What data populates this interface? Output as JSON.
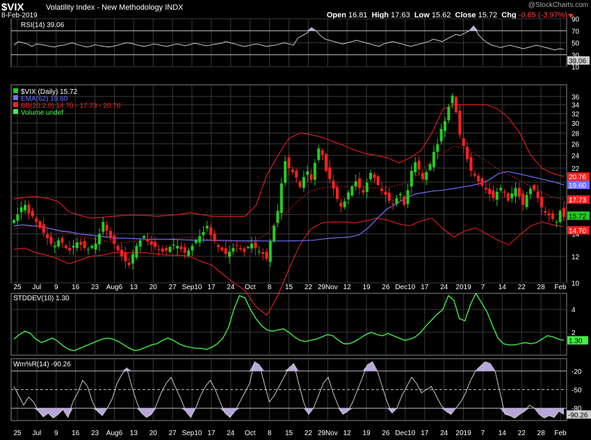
{
  "header": {
    "symbol": "$VIX",
    "name": "Volatility Index - New Methodology  INDX",
    "date": "8-Feb-2019",
    "watermark": "@StockCharts.com",
    "open_label": "Open",
    "open": "16.81",
    "high_label": "High",
    "high": "17.63",
    "low_label": "Low",
    "low": "15.62",
    "close_label": "Close",
    "close": "15.72",
    "chg_label": "Chg",
    "chg": "-0.65 (-3.97%)"
  },
  "colors": {
    "up": "#22cc22",
    "down": "#ff2020",
    "ema": "#7070ff",
    "bb": "#ff2020",
    "bb_mid": "#cc2020",
    "stddev": "#44ee44",
    "rsi": "#cccccc",
    "wmr": "#cccccc",
    "fill": "#b8a6d8",
    "grid": "#3a3a3a"
  },
  "chart_data": [
    {
      "type": "line",
      "panel": "RSI",
      "legend": "RSI(14) 39.06",
      "ylim": [
        10,
        90
      ],
      "yticks": [
        10,
        30,
        50,
        70,
        90
      ],
      "last_label": "39.06",
      "overbought": 70,
      "oversold": 30,
      "series": [
        {
          "name": "RSI(14)",
          "values": [
            46,
            52,
            50,
            48,
            44,
            48,
            47,
            46,
            44,
            43,
            45,
            46,
            48,
            50,
            47,
            45,
            43,
            44,
            47,
            45,
            44,
            43,
            44,
            46,
            48,
            50,
            49,
            47,
            45,
            44,
            46,
            48,
            47,
            45,
            44,
            46,
            48,
            47,
            45,
            47,
            49,
            48,
            46,
            45,
            47,
            48,
            49,
            52,
            50,
            48,
            46,
            44,
            45,
            47,
            48,
            46,
            44,
            45,
            46,
            48,
            50,
            48,
            46,
            58,
            62,
            66,
            75,
            70,
            62,
            56,
            54,
            52,
            50,
            48,
            50,
            52,
            54,
            52,
            50,
            48,
            46,
            44,
            48,
            50,
            52,
            50,
            48,
            46,
            44,
            46,
            48,
            50,
            52,
            56,
            54,
            52,
            56,
            60,
            64,
            62,
            66,
            70,
            78,
            64,
            56,
            50,
            46,
            44,
            42,
            44,
            46,
            44,
            42,
            40,
            42,
            44,
            46,
            44,
            42,
            40,
            38,
            40,
            39
          ]
        }
      ]
    },
    {
      "type": "candlestick",
      "panel": "price",
      "legend": [
        "$VIX (Daily) 15.72",
        "EMA(62) 19.60",
        "BB(20,2.0) 14.70 - 17.73 - 20.76",
        "Volume undef"
      ],
      "scale": "log",
      "ylim": [
        10,
        39
      ],
      "yticks": [
        10,
        12,
        14,
        16,
        18,
        20,
        22,
        24,
        26,
        28,
        30,
        32,
        34,
        36
      ],
      "xticks": [
        "25",
        "Jul",
        "9",
        "16",
        "23",
        "Aug6",
        "13",
        "20",
        "27",
        "Sep10",
        "17",
        "24",
        "Oct",
        "8",
        "15",
        "22",
        "29Nov",
        "12",
        "19",
        "26",
        "Dec10",
        "17",
        "24",
        "2019",
        "7",
        "14",
        "22",
        "28",
        "Feb"
      ],
      "last_labels": [
        "20.76",
        "19.60",
        "17.73",
        "15.72",
        "14.70"
      ],
      "close": [
        15.4,
        16.0,
        16.8,
        17.1,
        16.1,
        15.8,
        15.2,
        14.6,
        14.1,
        13.6,
        13.1,
        12.9,
        13.4,
        13.2,
        12.7,
        12.5,
        12.9,
        13.2,
        13.0,
        12.7,
        12.6,
        12.9,
        13.1,
        14.0,
        15.2,
        14.3,
        13.6,
        13.1,
        12.5,
        12.0,
        11.6,
        11.3,
        12.2,
        12.9,
        13.4,
        13.8,
        13.3,
        13.0,
        12.8,
        12.6,
        12.4,
        12.5,
        12.8,
        13.0,
        12.9,
        12.6,
        12.3,
        12.5,
        12.9,
        13.4,
        13.8,
        14.2,
        14.8,
        13.9,
        13.3,
        12.8,
        12.5,
        12.2,
        12.4,
        12.7,
        12.9,
        12.6,
        12.4,
        12.8,
        13.1,
        12.7,
        12.4,
        12.2,
        11.8,
        13.3,
        14.8,
        16.4,
        19.8,
        23.1,
        22.0,
        21.4,
        20.6,
        19.3,
        20.7,
        21.5,
        20.3,
        22.8,
        25.2,
        24.1,
        21.6,
        20.4,
        19.1,
        17.8,
        16.9,
        17.5,
        18.6,
        19.4,
        20.1,
        19.2,
        18.6,
        19.9,
        21.3,
        20.6,
        19.6,
        18.8,
        18.3,
        17.6,
        17.2,
        17.9,
        18.4,
        17.1,
        18.9,
        21.6,
        22.9,
        21.8,
        20.4,
        21.4,
        22.6,
        24.6,
        25.9,
        28.8,
        30.4,
        33.5,
        36.2,
        32.3,
        27.7,
        25.6,
        23.4,
        21.6,
        20.9,
        20.1,
        19.5,
        19.0,
        18.4,
        17.9,
        18.7,
        19.2,
        18.6,
        17.6,
        18.5,
        19.2,
        18.1,
        17.1,
        18.3,
        19.1,
        18.9,
        17.9,
        16.8,
        16.2,
        15.9,
        15.5,
        15.2,
        16.4,
        15.72
      ],
      "series": [
        {
          "name": "EMA(62)",
          "values": [
            14.8,
            14.9,
            14.8,
            14.7,
            14.5,
            14.3,
            14.2,
            14.0,
            13.9,
            13.8,
            13.7,
            13.6,
            13.6,
            13.55,
            13.5,
            13.5,
            13.5,
            13.48,
            13.45,
            13.42,
            13.42,
            13.4,
            13.4,
            13.38,
            13.36,
            13.35,
            13.35,
            13.34,
            13.34,
            13.34,
            13.35,
            13.36,
            13.4,
            13.5,
            13.6,
            13.65,
            13.7,
            13.9,
            14.6,
            15.6,
            16.6,
            17.2,
            17.9,
            18.4,
            18.6,
            18.8,
            18.9,
            19.1,
            19.3,
            19.5,
            19.8,
            20.3,
            21.2,
            21.5,
            21.2,
            20.9,
            20.6,
            20.3,
            20.0,
            19.6
          ]
        },
        {
          "name": "BB upper",
          "values": [
            17.8,
            18.0,
            18.1,
            17.9,
            17.5,
            16.3,
            15.9,
            15.6,
            15.7,
            15.8,
            15.9,
            15.9,
            15.9,
            15.8,
            15.9,
            16.0,
            16.2,
            16.0,
            15.8,
            15.8,
            15.8,
            15.8,
            17.0,
            21.0,
            24.0,
            27.0,
            28.0,
            27.7,
            27.2,
            26.4,
            25.7,
            24.9,
            24.3,
            24.0,
            23.6,
            22.8,
            23.6,
            24.8,
            28.0,
            33.0,
            34.0,
            34.0,
            34.0,
            34.0,
            33.0,
            31.0,
            28.0,
            24.0,
            22.0,
            21.2,
            20.76
          ]
        },
        {
          "name": "BB middle",
          "values": [
            14.5,
            14.7,
            14.8,
            14.6,
            14.3,
            14.1,
            13.8,
            13.6,
            13.4,
            13.2,
            13.2,
            13.3,
            13.4,
            13.5,
            13.5,
            13.6,
            13.7,
            13.6,
            13.4,
            13.3,
            13.3,
            13.2,
            13.4,
            14.0,
            15.5,
            16.5,
            17.8,
            18.8,
            19.2,
            19.4,
            19.4,
            19.4,
            19.3,
            19.2,
            19.3,
            19.6,
            20.1,
            21.4,
            23.2,
            24.4,
            25.6,
            25.2,
            24.2,
            23.0,
            21.9,
            21.0,
            20.2,
            19.4,
            18.6,
            18.0,
            17.73
          ]
        },
        {
          "name": "BB lower",
          "values": [
            12.6,
            12.7,
            12.3,
            12.1,
            11.8,
            11.4,
            11.7,
            12.0,
            12.1,
            12.3,
            12.3,
            12.3,
            12.3,
            12.2,
            12.1,
            12.1,
            12.0,
            11.6,
            11.3,
            10.6,
            10.0,
            9.5,
            8.5,
            8.0,
            9.2,
            11.0,
            13.0,
            14.5,
            15.1,
            15.2,
            15.2,
            15.1,
            15.3,
            15.6,
            15.4,
            15.0,
            14.8,
            15.3,
            15.6,
            14.5,
            13.7,
            14.3,
            14.6,
            14.0,
            13.4,
            13.0,
            13.9,
            14.8,
            15.2,
            14.9,
            14.7
          ]
        }
      ]
    },
    {
      "type": "line",
      "panel": "STDDEV",
      "legend": "STDDEV(10) 1.30",
      "ylim": [
        0,
        5.4
      ],
      "yticks": [
        2,
        4
      ],
      "last_label": "1.30",
      "series": [
        {
          "name": "STDDEV(10)",
          "values": [
            1.4,
            1.8,
            2.1,
            1.9,
            1.4,
            1.1,
            1.3,
            1.5,
            1.2,
            0.8,
            0.5,
            0.4,
            0.6,
            0.8,
            1.0,
            1.2,
            1.4,
            1.5,
            1.4,
            1.2,
            0.9,
            0.6,
            0.4,
            0.5,
            0.7,
            0.9,
            1.0,
            1.3,
            1.5,
            1.3,
            1.0,
            0.8,
            0.7,
            0.6,
            0.6,
            0.5,
            0.7,
            1.0,
            1.5,
            2.4,
            4.0,
            5.2,
            5.0,
            4.0,
            3.2,
            2.6,
            2.2,
            2.1,
            2.2,
            2.3,
            2.0,
            1.6,
            1.3,
            1.2,
            1.3,
            1.4,
            1.6,
            1.8,
            1.7,
            1.3,
            1.0,
            1.0,
            1.2,
            1.5,
            1.8,
            2.0,
            1.8,
            1.7,
            1.9,
            1.7,
            1.5,
            1.3,
            1.4,
            1.6,
            2.0,
            2.6,
            3.1,
            3.6,
            4.0,
            5.2,
            4.8,
            3.2,
            3.0,
            4.4,
            5.4,
            4.6,
            3.8,
            2.6,
            1.5,
            1.0,
            0.9,
            0.9,
            1.0,
            1.1,
            1.0,
            1.1,
            1.4,
            1.7,
            1.6,
            1.4,
            1.3
          ]
        }
      ]
    },
    {
      "type": "line",
      "panel": "Wm%R",
      "legend": "Wm%R(14) -90.26",
      "ylim": [
        -100,
        0
      ],
      "yticks": [
        -20,
        -50,
        -80
      ],
      "last_label": "-90.26",
      "overbought": -20,
      "oversold": -80,
      "xticks": [
        "25",
        "Jul",
        "9",
        "16",
        "23",
        "Aug6",
        "13",
        "20",
        "27",
        "Sep10",
        "17",
        "24",
        "Oct",
        "8",
        "15",
        "22",
        "29Nov",
        "12",
        "19",
        "26",
        "Dec10",
        "17",
        "24",
        "2019",
        "7",
        "14",
        "22",
        "28",
        "Feb"
      ],
      "series": [
        {
          "name": "Wm%R(14)",
          "values": [
            -45,
            -60,
            -75,
            -62,
            -70,
            -85,
            -94,
            -88,
            -96,
            -90,
            -82,
            -95,
            -70,
            -55,
            -35,
            -45,
            -70,
            -85,
            -92,
            -80,
            -65,
            -40,
            -25,
            -15,
            -45,
            -70,
            -88,
            -95,
            -90,
            -75,
            -55,
            -40,
            -30,
            -48,
            -65,
            -85,
            -95,
            -80,
            -60,
            -45,
            -35,
            -50,
            -70,
            -88,
            -95,
            -85,
            -70,
            -55,
            -40,
            -5,
            -10,
            -40,
            -70,
            -60,
            -45,
            -30,
            -15,
            -8,
            -40,
            -70,
            -90,
            -80,
            -60,
            -40,
            -30,
            -55,
            -75,
            -90,
            -85,
            -70,
            -50,
            -30,
            -10,
            -5,
            -20,
            -45,
            -70,
            -88,
            -80,
            -60,
            -45,
            -30,
            -40,
            -55,
            -50,
            -45,
            -60,
            -75,
            -85,
            -90,
            -80,
            -70,
            -55,
            -35,
            -20,
            -12,
            -5,
            -8,
            -20,
            -55,
            -90,
            -92,
            -96,
            -90,
            -85,
            -75,
            -80,
            -90,
            -96,
            -92,
            -95,
            -85,
            -90
          ]
        }
      ]
    }
  ]
}
